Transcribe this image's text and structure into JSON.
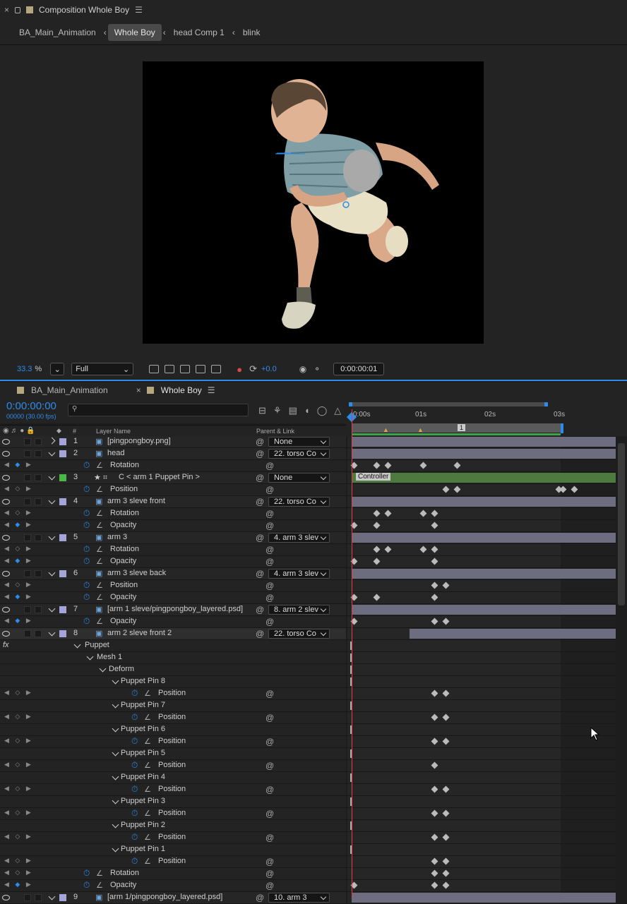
{
  "comp_panel": {
    "title": "Composition Whole Boy",
    "close": "×",
    "menu": "☰"
  },
  "breadcrumbs": [
    "BA_Main_Animation",
    "Whole Boy",
    "head Comp 1",
    "blink"
  ],
  "viewer": {
    "zoom": "33.3",
    "zoom_unit": "%",
    "resolution": "Full",
    "exposure": "+0.0",
    "timecode": "0:00:00:01"
  },
  "timeline": {
    "tabs": [
      "BA_Main_Animation",
      "Whole Boy"
    ],
    "timecode": "0:00:00:00",
    "fps": "00000 (30.00 fps)",
    "search_placeholder": "",
    "col": {
      "num": "#",
      "layer_name": "Layer Name",
      "parent": "Parent & Link"
    },
    "ruler": [
      "0:00s",
      "01s",
      "02s",
      "03s"
    ],
    "marker": "1",
    "controller_label": "Controller"
  },
  "rows": [
    {
      "type": "layer",
      "idx": "1",
      "name": "[pingpongboy.png]",
      "parent": "None",
      "twirl": "closed"
    },
    {
      "type": "layer",
      "idx": "2",
      "name": "head",
      "parent": "22. torso Co"
    },
    {
      "type": "prop",
      "name": "Rotation",
      "depth": 1
    },
    {
      "type": "layer",
      "idx": "3",
      "name": "C < arm 1  Puppet Pin >",
      "parent": "None",
      "green": true
    },
    {
      "type": "prop",
      "name": "Position",
      "depth": 1
    },
    {
      "type": "layer",
      "idx": "4",
      "name": "arm 3 sleve front",
      "parent": "22. torso Co"
    },
    {
      "type": "prop",
      "name": "Rotation",
      "depth": 1
    },
    {
      "type": "prop",
      "name": "Opacity",
      "depth": 1
    },
    {
      "type": "layer",
      "idx": "5",
      "name": "arm 3",
      "parent": "4. arm 3 slev"
    },
    {
      "type": "prop",
      "name": "Rotation",
      "depth": 1
    },
    {
      "type": "prop",
      "name": "Opacity",
      "depth": 1
    },
    {
      "type": "layer",
      "idx": "6",
      "name": "arm 3 sleve back",
      "parent": "4. arm 3 slev"
    },
    {
      "type": "prop",
      "name": "Position",
      "depth": 1
    },
    {
      "type": "prop",
      "name": "Opacity",
      "depth": 1
    },
    {
      "type": "layer",
      "idx": "7",
      "name": "[arm 1 sleve/pingpongboy_layered.psd]",
      "parent": "8. arm 2 slev"
    },
    {
      "type": "prop",
      "name": "Opacity",
      "depth": 1
    },
    {
      "type": "layer",
      "idx": "8",
      "name": "arm 2 sleve front 2",
      "parent": "22. torso Co",
      "sel": true
    },
    {
      "type": "group",
      "name": "Puppet",
      "depth": 0,
      "fx": true
    },
    {
      "type": "group",
      "name": "Mesh 1",
      "depth": 1
    },
    {
      "type": "group",
      "name": "Deform",
      "depth": 2
    },
    {
      "type": "group",
      "name": "Puppet Pin 8",
      "depth": 3
    },
    {
      "type": "prop",
      "name": "Position",
      "depth": 4
    },
    {
      "type": "group",
      "name": "Puppet Pin 7",
      "depth": 3
    },
    {
      "type": "prop",
      "name": "Position",
      "depth": 4
    },
    {
      "type": "group",
      "name": "Puppet Pin 6",
      "depth": 3
    },
    {
      "type": "prop",
      "name": "Position",
      "depth": 4
    },
    {
      "type": "group",
      "name": "Puppet Pin 5",
      "depth": 3
    },
    {
      "type": "prop",
      "name": "Position",
      "depth": 4
    },
    {
      "type": "group",
      "name": "Puppet Pin 4",
      "depth": 3
    },
    {
      "type": "prop",
      "name": "Position",
      "depth": 4
    },
    {
      "type": "group",
      "name": "Puppet Pin 3",
      "depth": 3
    },
    {
      "type": "prop",
      "name": "Position",
      "depth": 4
    },
    {
      "type": "group",
      "name": "Puppet Pin 2",
      "depth": 3
    },
    {
      "type": "prop",
      "name": "Position",
      "depth": 4
    },
    {
      "type": "group",
      "name": "Puppet Pin 1",
      "depth": 3
    },
    {
      "type": "prop",
      "name": "Position",
      "depth": 4
    },
    {
      "type": "prop",
      "name": "Rotation",
      "depth": 1
    },
    {
      "type": "prop",
      "name": "Opacity",
      "depth": 1
    },
    {
      "type": "layer",
      "idx": "9",
      "name": "[arm 1/pingpongboy_layered.psd]",
      "parent": "10. arm 3"
    }
  ],
  "colors": {
    "accent": "#2d8ceb",
    "layer_bar": "#6e6d80",
    "controller_bar": "#4d7a3e",
    "label_lavender": "#a4a4d8",
    "label_green": "#49b84a"
  }
}
